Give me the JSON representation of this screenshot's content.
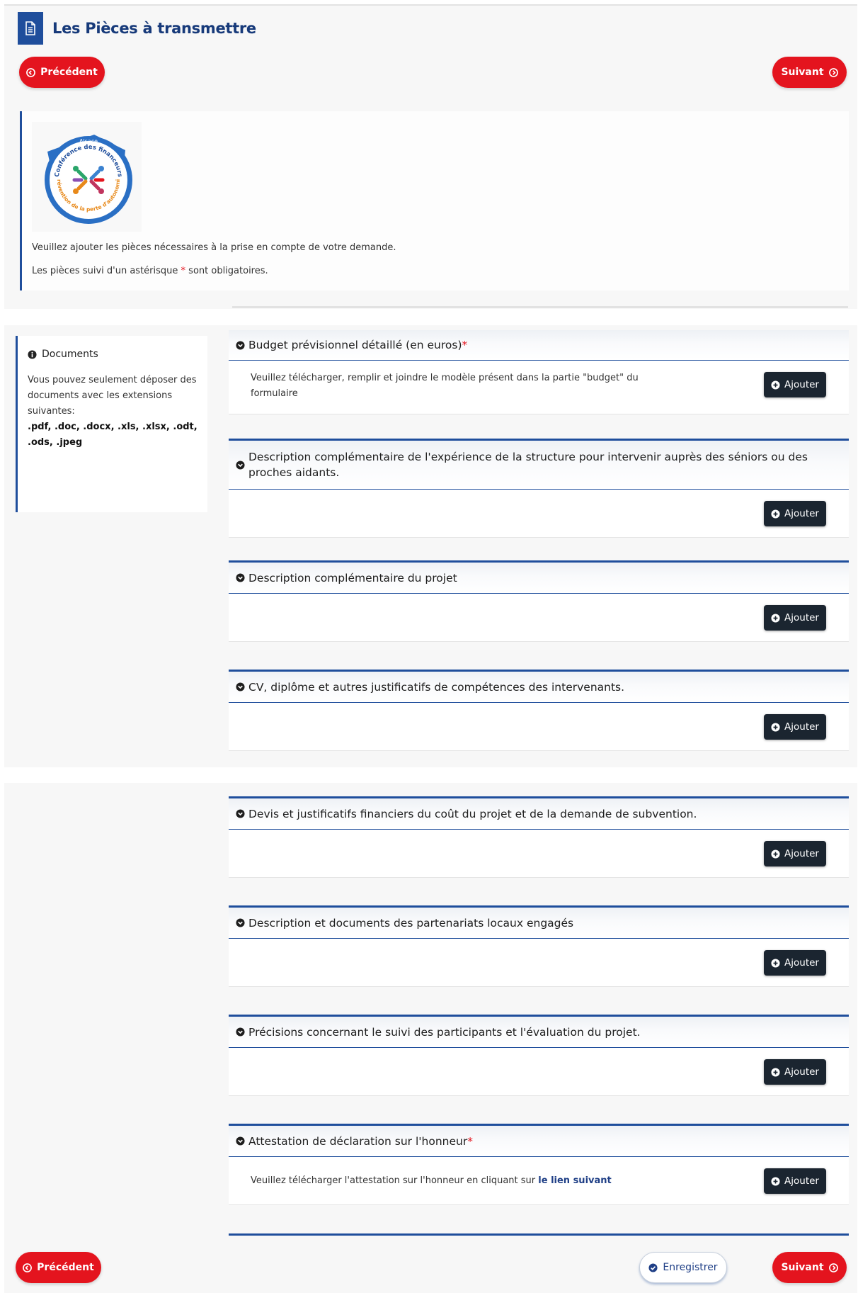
{
  "header": {
    "title": "Les Pièces à transmettre",
    "icon": "document-icon"
  },
  "nav": {
    "previous_label": "Précédent",
    "next_label": "Suivant",
    "save_label": "Enregistrer"
  },
  "intro": {
    "logo_lettering": [
      "Alsace",
      "Conférence des financeurs",
      "Prévention de la perte d'autonomie"
    ],
    "line1": "Veuillez ajouter les pièces nécessaires à la prise en compte de votre demande.",
    "line2_prefix": "Les pièces suivi d'un astérisque",
    "asterisk": "*",
    "line2_suffix": "sont obligatoires."
  },
  "info": {
    "title": "Documents",
    "body": "Vous pouvez seulement déposer des documents avec les extensions suivantes:",
    "extensions": ".pdf, .doc, .docx, .xls, .xlsx, .odt, .ods, .jpeg"
  },
  "sections": [
    {
      "title": "Budget prévisionnel détaillé (en euros)",
      "required": "*",
      "note": "Veuillez télécharger, remplir et joindre le modèle présent dans la partie \"budget\" du formulaire",
      "add_label": "Ajouter"
    },
    {
      "title": "Description complémentaire de l'expérience de la structure pour intervenir auprès des séniors ou des proches aidants.",
      "add_label": "Ajouter"
    },
    {
      "title": "Description complémentaire du projet",
      "add_label": "Ajouter"
    },
    {
      "title": "CV, diplôme et autres justificatifs de compétences des intervenants.",
      "add_label": "Ajouter"
    },
    {
      "title": "Devis et justificatifs financiers du coût du projet et de la demande de subvention.",
      "add_label": "Ajouter"
    },
    {
      "title": "Description et documents des partenariats locaux engagés",
      "add_label": "Ajouter"
    },
    {
      "title": "Précisions concernant le suivi des participants et l'évaluation du projet.",
      "add_label": "Ajouter"
    },
    {
      "title": "Attestation de déclaration sur l'honneur",
      "required": "*",
      "note_prefix": "Veuillez télécharger l'attestation sur l'honneur en cliquant sur",
      "note_link": "le lien suivant",
      "add_label": "Ajouter"
    }
  ],
  "colors": {
    "primary_blue": "#1f4e9c",
    "accent_red": "#e4141e",
    "dark_button": "#1b2530"
  }
}
